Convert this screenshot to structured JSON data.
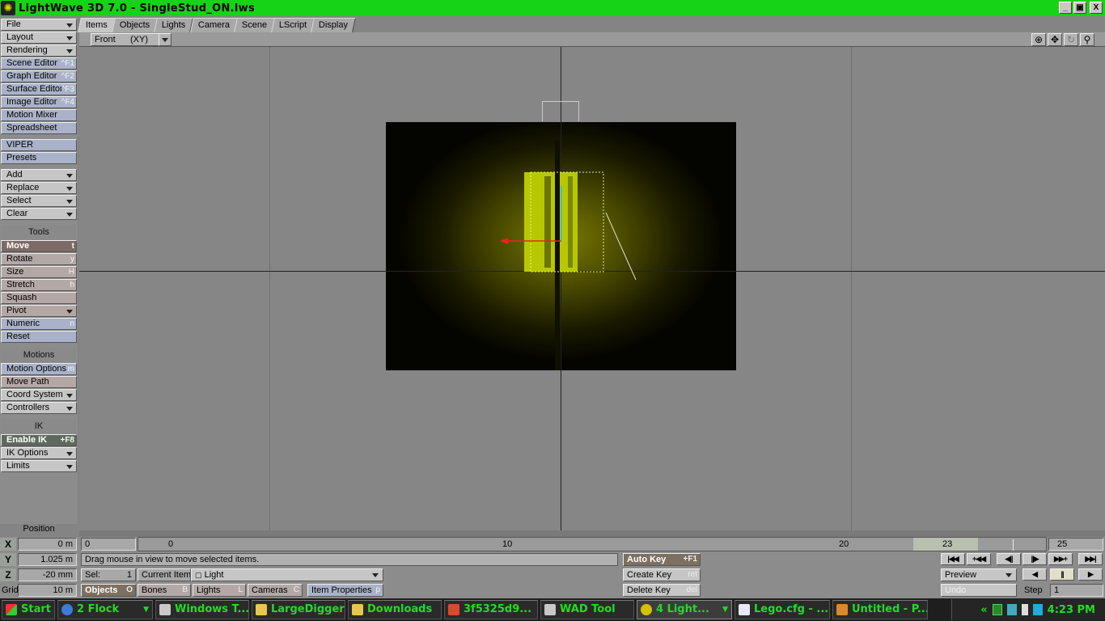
{
  "window": {
    "title": "LightWave 3D 7.0 - SingleStud_ON.lws",
    "min": "_",
    "max": "▣",
    "close": "X"
  },
  "left_menu": {
    "file": "File",
    "layout": "Layout",
    "rendering": "Rendering",
    "scene_editor": "Scene Editor",
    "scene_editor_sc": "^F1",
    "graph_editor": "Graph Editor",
    "graph_editor_sc": "^F2",
    "surface_editor": "Surface Editor",
    "surface_editor_sc": "^F3",
    "image_editor": "Image Editor",
    "image_editor_sc": "^F4",
    "motion_mixer": "Motion Mixer",
    "spreadsheet": "Spreadsheet",
    "viper": "VIPER",
    "presets": "Presets",
    "add": "Add",
    "replace": "Replace",
    "select": "Select",
    "clear": "Clear",
    "tools_header": "Tools",
    "move": "Move",
    "move_sc": "t",
    "rotate": "Rotate",
    "rotate_sc": "y",
    "size": "Size",
    "size_sc": "H",
    "stretch": "Stretch",
    "stretch_sc": "h",
    "squash": "Squash",
    "pivot": "Pivot",
    "numeric": "Numeric",
    "numeric_sc": "n",
    "reset": "Reset",
    "motions_header": "Motions",
    "motion_options": "Motion Options",
    "motion_options_sc": "m",
    "move_path": "Move Path",
    "coord_system": "Coord System",
    "controllers": "Controllers",
    "ik_header": "IK",
    "enable_ik": "Enable IK",
    "enable_ik_sc": "+F8",
    "ik_options": "IK Options",
    "limits": "Limits",
    "position_label": "Position"
  },
  "tabs": [
    "Items",
    "Objects",
    "Lights",
    "Camera",
    "Scene",
    "LScript",
    "Display"
  ],
  "viewport": {
    "view": "Front",
    "axis": "(XY)"
  },
  "coords": {
    "x_label": "X",
    "x": "0 m",
    "y_label": "Y",
    "y": "1.025 m",
    "z_label": "Z",
    "z": "-20 mm",
    "grid_label": "Grid:",
    "grid": "10 m"
  },
  "timeline": {
    "start": "0",
    "end": "25",
    "current": "23",
    "tick_labels": [
      "0",
      "10",
      "20"
    ]
  },
  "status": "Drag mouse in view to move selected items.",
  "sel_label": "Sel:",
  "sel_value": "1",
  "current_item_label": "Current Item",
  "current_item": "Light",
  "item_types": {
    "objects": "Objects",
    "objects_sc": "O",
    "bones": "Bones",
    "bones_sc": "B",
    "lights": "Lights",
    "lights_sc": "L",
    "cameras": "Cameras",
    "cameras_sc": "C"
  },
  "item_properties": "Item Properties",
  "item_properties_sc": "p",
  "keys": {
    "auto_key": "Auto Key",
    "auto_key_sc": "+F1",
    "create_key": "Create Key",
    "create_key_sc": "ret",
    "delete_key": "Delete Key",
    "delete_key_sc": "del"
  },
  "playback": {
    "preview": "Preview",
    "undo": "Undo",
    "step_label": "Step",
    "step": "1"
  },
  "taskbar": {
    "start": "Start",
    "items": [
      "2 Flock",
      "Windows T...",
      "LargeDigger",
      "Downloads",
      "3f5325d9...",
      "WAD Tool",
      "4 Light...",
      "Lego.cfg - ...",
      "Untitled - P..."
    ],
    "clock": "4:23 PM",
    "chevron": "«"
  },
  "colors": {
    "title_bar": "#17d317",
    "taskbar_text": "#22dd22",
    "move_active": "#7d6a66"
  }
}
